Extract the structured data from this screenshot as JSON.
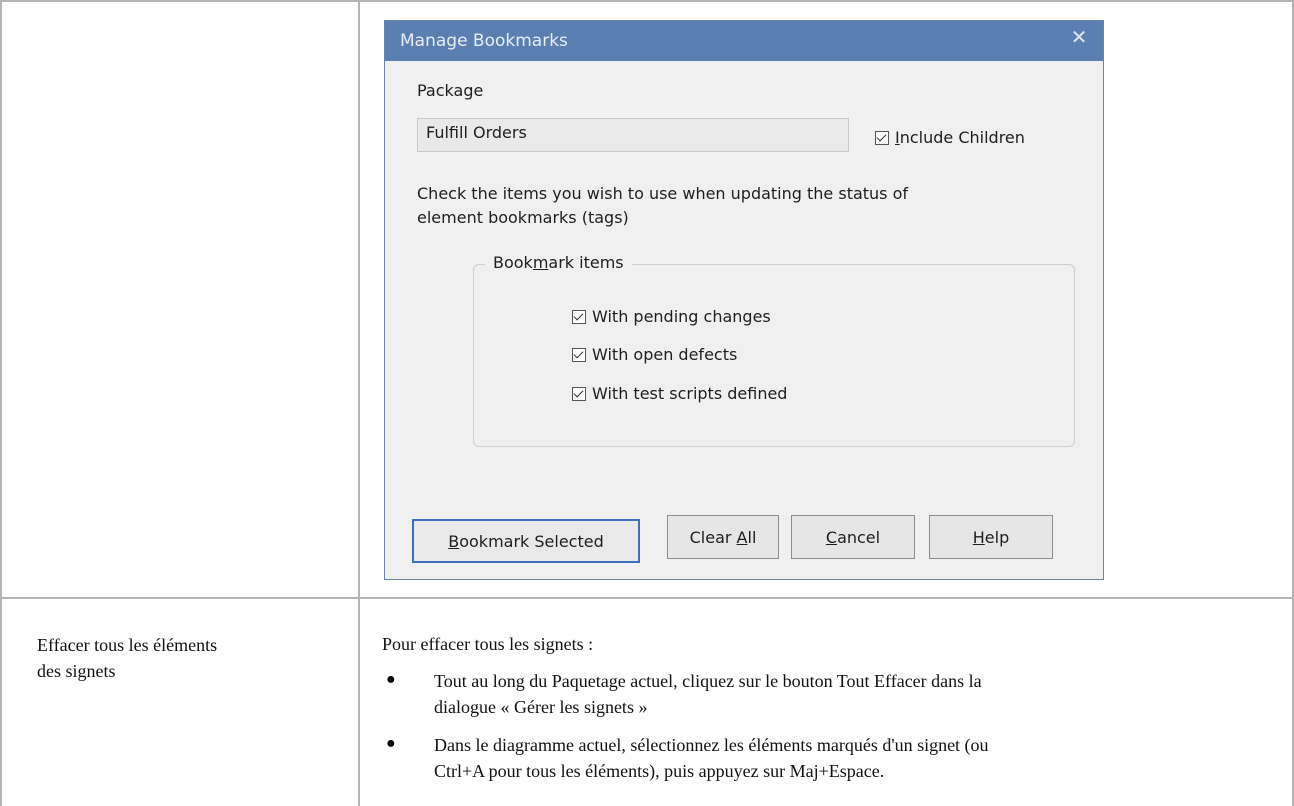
{
  "dialog": {
    "title": "Manage Bookmarks",
    "close_glyph": "✕",
    "package_label": "Package",
    "package_value": "Fulfill Orders",
    "include_children": {
      "label": "Include Children",
      "checked": true
    },
    "instructions": [
      "Check the items you wish to use when updating the status of",
      "element bookmarks (tags)"
    ],
    "group": {
      "legend": "Bookmark items",
      "items": [
        {
          "label": "With pending changes",
          "checked": true
        },
        {
          "label": "With open defects",
          "checked": true
        },
        {
          "label": "With test scripts defined",
          "checked": true
        }
      ]
    },
    "buttons": {
      "bookmark_selected": "Bookmark Selected",
      "clear_all": "Clear All",
      "cancel": "Cancel",
      "help": "Help"
    }
  },
  "row2": {
    "left_label": [
      "Effacer tous les éléments",
      "des signets"
    ],
    "intro": "Pour effacer tous les signets :",
    "bullets": [
      [
        "Tout au long du Paquetage actuel, cliquez sur le bouton Tout Effacer dans la",
        "dialogue « Gérer les signets »"
      ],
      [
        "Dans le diagramme actuel, sélectionnez les éléments marqués d'un signet (ou",
        "Ctrl+A pour tous les éléments), puis appuyez sur Maj+Espace."
      ]
    ]
  }
}
